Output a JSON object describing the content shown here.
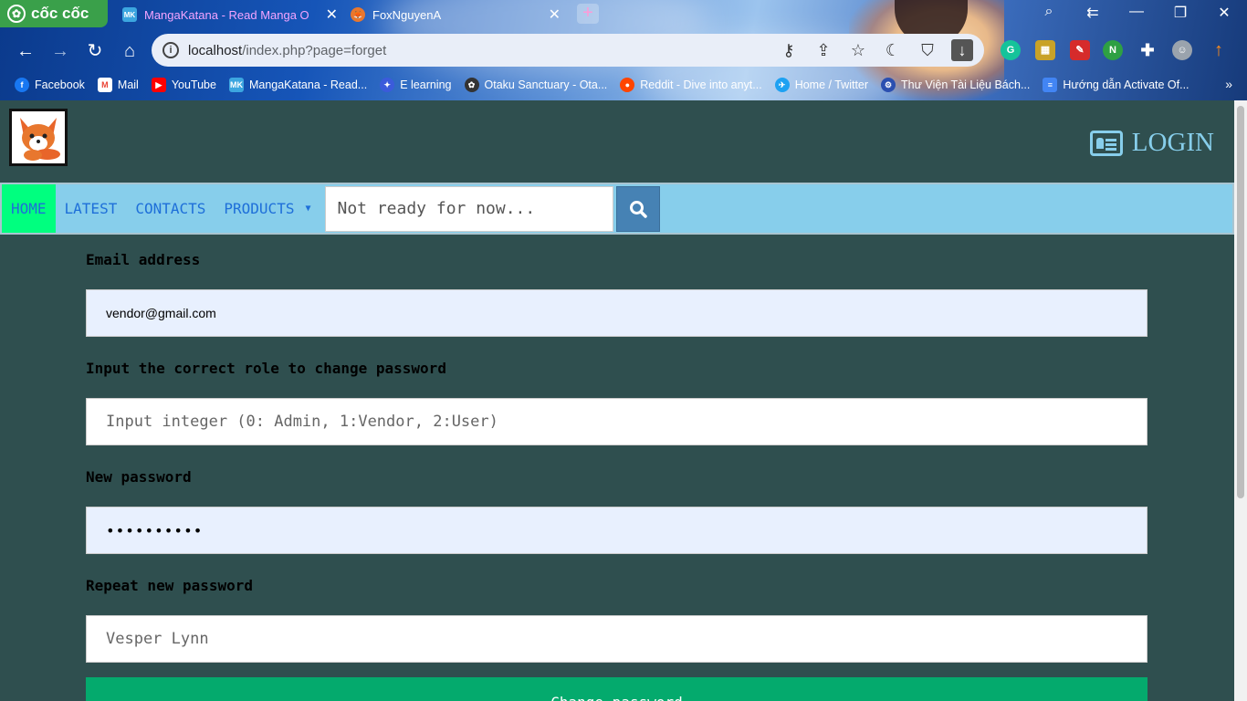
{
  "browser": {
    "brand": "cốc cốc",
    "tabs": [
      {
        "title": "MangaKatana - Read Manga O",
        "favicon": "MK"
      },
      {
        "title": "FoxNguyenA",
        "favicon": "fox-icon"
      }
    ],
    "url_host": "localhost",
    "url_path": "/index.php?page=forget",
    "bookmarks": [
      {
        "label": "Facebook",
        "icon": "facebook-icon",
        "color": "#1877f2"
      },
      {
        "label": "Mail",
        "icon": "gmail-icon",
        "color": "#ea4335"
      },
      {
        "label": "YouTube",
        "icon": "youtube-icon",
        "color": "#ff0000"
      },
      {
        "label": "MangaKatana - Read...",
        "icon": "MK",
        "color": "#3ca6e0"
      },
      {
        "label": "E learning",
        "icon": "elearning-icon",
        "color": "#3b5bdb"
      },
      {
        "label": "Otaku Sanctuary - Ota...",
        "icon": "otaku-icon",
        "color": "#333333"
      },
      {
        "label": "Reddit - Dive into anyt...",
        "icon": "reddit-icon",
        "color": "#ff4500"
      },
      {
        "label": "Home / Twitter",
        "icon": "twitter-icon",
        "color": "#1da1f2"
      },
      {
        "label": "Thư Viện Tài Liệu Bách...",
        "icon": "library-icon",
        "color": "#2b4fb0"
      },
      {
        "label": "Hướng dẫn Activate Of...",
        "icon": "doc-icon",
        "color": "#4285f4"
      }
    ]
  },
  "header": {
    "login_label": "LOGIN"
  },
  "nav": {
    "items": [
      "HOME",
      "LATEST",
      "CONTACTS",
      "PRODUCTS"
    ],
    "search_placeholder": "Not ready for now..."
  },
  "form": {
    "email_label": "Email address",
    "email_value": "vendor@gmail.com",
    "role_label": "Input the correct role to change password",
    "role_placeholder": "Input integer (0: Admin, 1:Vendor, 2:User)",
    "newpw_label": "New password",
    "newpw_value": "••••••••••",
    "repeat_label": "Repeat new password",
    "repeat_placeholder": "Vesper Lynn",
    "submit_label": "Change password"
  },
  "colors": {
    "page_bg": "#2f4f4f",
    "navbar_bg": "#87ceeb",
    "home_active": "#00ff7f",
    "search_button": "#4682b4",
    "submit_button": "#04aa6d"
  }
}
